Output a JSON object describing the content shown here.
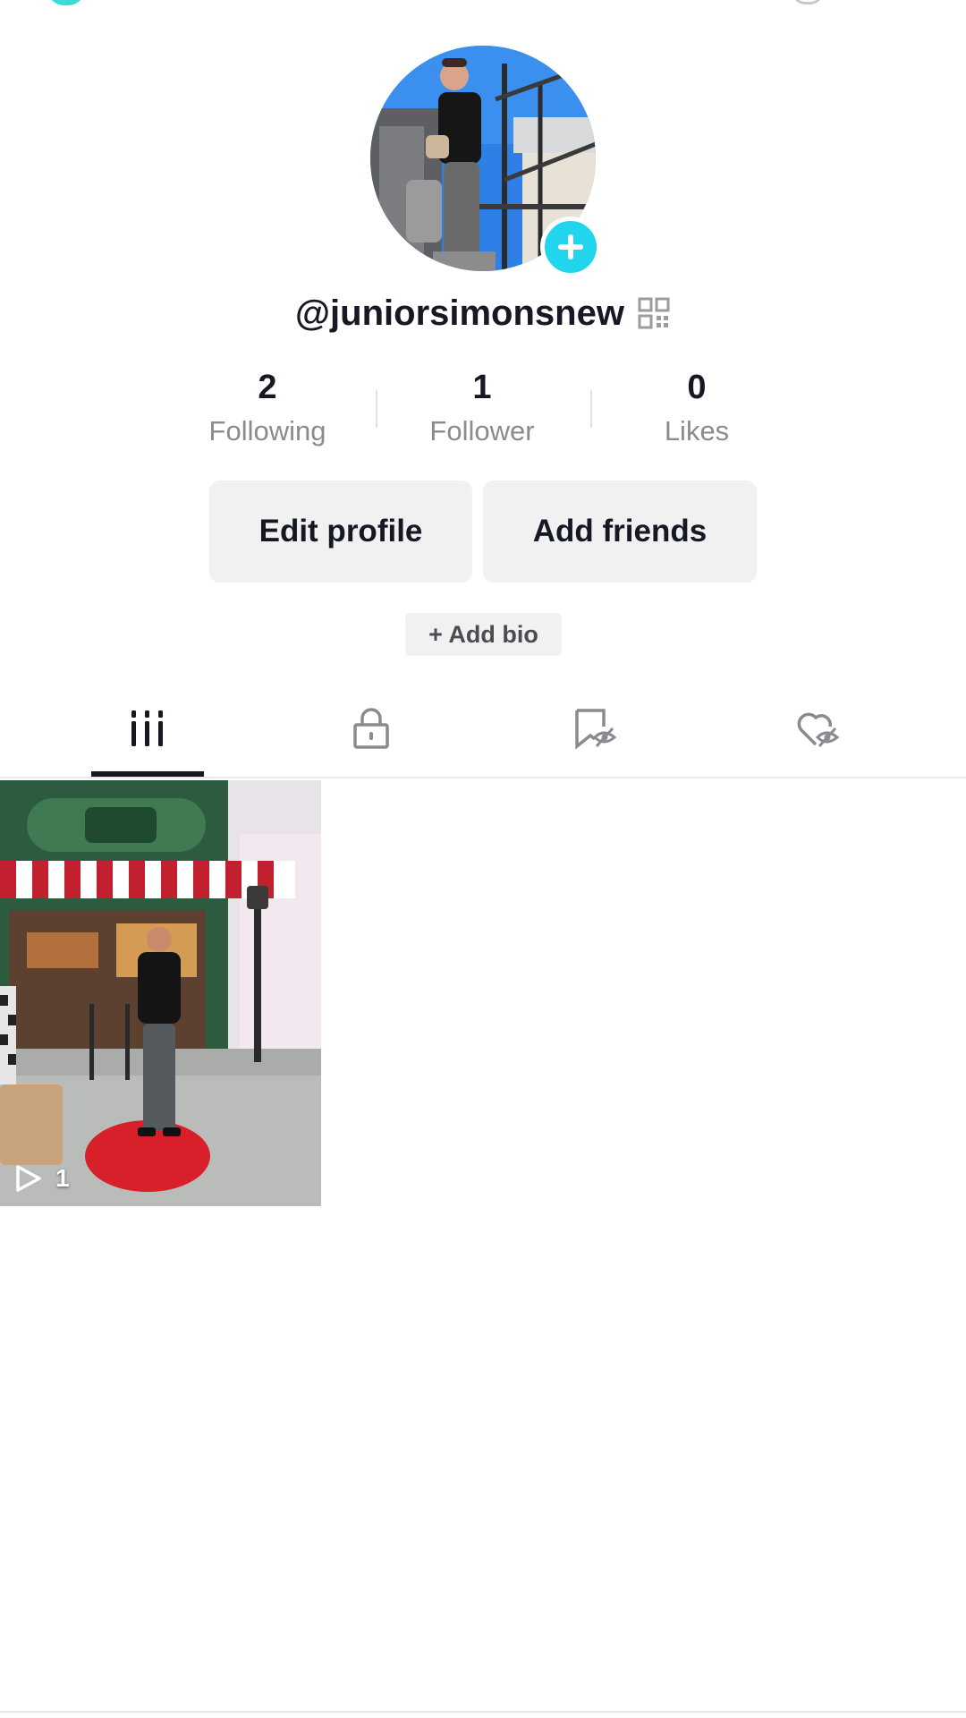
{
  "profile": {
    "username": "@juniorsimonsnew",
    "avatar_icon": "profile-photo",
    "add_avatar_icon": "plus-icon",
    "qr_icon": "qr-code-icon",
    "accent_color": "#20d5ec"
  },
  "stats": [
    {
      "value": "2",
      "label": "Following"
    },
    {
      "value": "1",
      "label": "Follower"
    },
    {
      "value": "0",
      "label": "Likes"
    }
  ],
  "actions": {
    "edit_profile": "Edit profile",
    "add_friends": "Add friends",
    "add_bio": "+ Add bio"
  },
  "tabs": [
    {
      "icon": "videos-grid-icon",
      "active": true
    },
    {
      "icon": "lock-icon",
      "active": false
    },
    {
      "icon": "hidden-bookmark-icon",
      "active": false
    },
    {
      "icon": "hidden-heart-icon",
      "active": false
    }
  ],
  "videos": [
    {
      "play_count": "1",
      "thumbnail_icon": "video-thumbnail",
      "play_icon": "play-icon"
    }
  ]
}
